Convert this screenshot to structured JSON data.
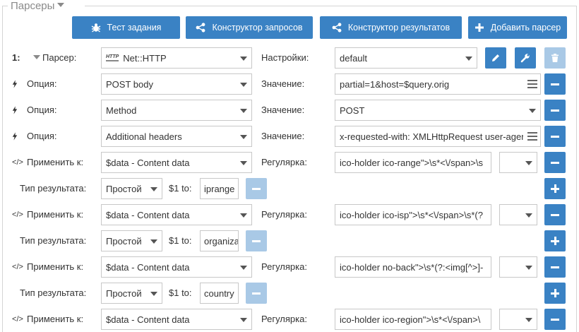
{
  "legend": {
    "title": "Парсеры"
  },
  "toolbar": {
    "test": "Тест задания",
    "query_builder": "Конструктор запросов",
    "result_builder": "Конструктор результатов",
    "add_parser": "Добавить парсер"
  },
  "parser": {
    "index": "1:",
    "label": "Парсер:",
    "value": "Net::HTTP",
    "settings_label": "Настройки:",
    "settings_value": "default"
  },
  "options": [
    {
      "label": "Опция:",
      "value": "POST body",
      "value_label": "Значение:",
      "val": "partial=1&host=$query.orig"
    },
    {
      "label": "Опция:",
      "value": "Method",
      "value_label": "Значение:",
      "val": "POST"
    },
    {
      "label": "Опция:",
      "value": "Additional headers",
      "value_label": "Значение:",
      "val": "x-requested-with: XMLHttpRequest user-agent"
    }
  ],
  "apply": [
    {
      "label": "Применить к:",
      "source": "$data - Content data",
      "regex_label": "Регулярка:",
      "regex": "ico-holder ico-range\">\\s*<\\/span>\\s"
    },
    {
      "label": "Применить к:",
      "source": "$data - Content data",
      "regex_label": "Регулярка:",
      "regex": "ico-holder ico-isp\">\\s*<\\/span>\\s*(?"
    },
    {
      "label": "Применить к:",
      "source": "$data - Content data",
      "regex_label": "Регулярка:",
      "regex": "ico-holder no-back\">\\s*(?:<img[^>]-"
    },
    {
      "label": "Применить к:",
      "source": "$data - Content data",
      "regex_label": "Регулярка:",
      "regex": "ico-holder ico-region\">\\s*<\\/span>\\"
    }
  ],
  "results": [
    {
      "label": "Тип результата:",
      "type": "Простой",
      "to_label": "$1 to:",
      "to": "iprange"
    },
    {
      "label": "Тип результата:",
      "type": "Простой",
      "to_label": "$1 to:",
      "to": "organization"
    },
    {
      "label": "Тип результата:",
      "type": "Простой",
      "to_label": "$1 to:",
      "to": "country"
    }
  ],
  "colors": {
    "primary": "#3a82c4",
    "disabled": "#a9c9e6",
    "border": "#c8c8c8"
  }
}
